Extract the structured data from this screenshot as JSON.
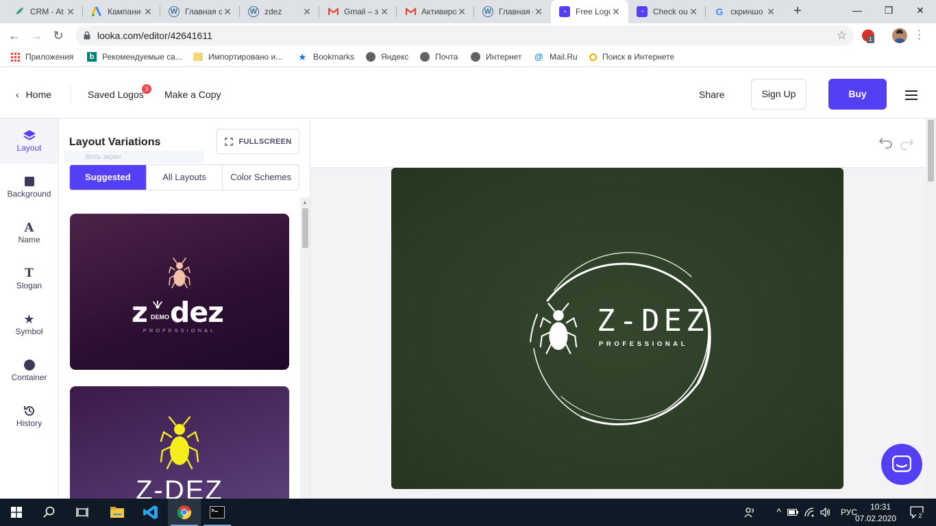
{
  "browser": {
    "tabs": [
      {
        "title": "CRM - At",
        "icon": "feather-icon"
      },
      {
        "title": "Кампани",
        "icon": "google-ads-icon"
      },
      {
        "title": "Главная с",
        "icon": "wordpress-icon"
      },
      {
        "title": "zdez",
        "icon": "wordpress-icon"
      },
      {
        "title": "Gmail – з",
        "icon": "gmail-icon"
      },
      {
        "title": "Активиро",
        "icon": "gmail-icon"
      },
      {
        "title": "Главная с",
        "icon": "wordpress-icon"
      },
      {
        "title": "Free Logo",
        "icon": "looka-icon",
        "active": true
      },
      {
        "title": "Check ou",
        "icon": "looka-icon"
      },
      {
        "title": "скриншо",
        "icon": "google-icon"
      }
    ],
    "url": "looka.com/editor/42641611",
    "bookmarks": [
      {
        "label": "Приложения",
        "icon": "apps-grid-icon"
      },
      {
        "label": "Рекомендуемые са...",
        "icon": "bing-icon"
      },
      {
        "label": "Импортировано и...",
        "icon": "folder-icon"
      },
      {
        "label": "Bookmarks",
        "icon": "star-icon"
      },
      {
        "label": "Яндекс",
        "icon": "globe-icon"
      },
      {
        "label": "Почта",
        "icon": "globe-icon"
      },
      {
        "label": "Интернет",
        "icon": "globe-icon"
      },
      {
        "label": "Mail.Ru",
        "icon": "mailru-icon"
      },
      {
        "label": "Поиск в Интернете",
        "icon": "search-icon"
      }
    ],
    "extension_badge": "1"
  },
  "header": {
    "home": "Home",
    "saved_logos": "Saved Logos",
    "saved_count": "3",
    "make_copy": "Make a Copy",
    "share": "Share",
    "sign_up": "Sign Up",
    "buy": "Buy"
  },
  "rail": [
    {
      "label": "Layout",
      "icon": "layers-icon",
      "selected": true
    },
    {
      "label": "Background",
      "icon": "square-icon"
    },
    {
      "label": "Name",
      "icon": "letter-a-icon"
    },
    {
      "label": "Slogan",
      "icon": "letter-t-icon"
    },
    {
      "label": "Symbol",
      "icon": "star-icon"
    },
    {
      "label": "Container",
      "icon": "circle-icon"
    },
    {
      "label": "History",
      "icon": "history-icon"
    }
  ],
  "panel": {
    "title": "Layout Variations",
    "fullscreen": "FULLSCREEN",
    "tooltip": "Весь экран",
    "tabs": [
      "Suggested",
      "All Layouts",
      "Color Schemes"
    ],
    "card1": {
      "left_letter": "z",
      "name": "dez",
      "demo": "DEMO",
      "slogan": "PROFESSIONAL"
    },
    "card2": {
      "name": "Z-DEZ"
    }
  },
  "logo": {
    "name": "Z-DEZ",
    "slogan": "PROFESSIONAL",
    "background": "#2f4128"
  },
  "colors": {
    "accent": "#5340f5",
    "badge": "#f0434b"
  },
  "taskbar": {
    "lang": "РУС",
    "time": "10:31",
    "date": "07.02.2020",
    "notifications": "2"
  }
}
